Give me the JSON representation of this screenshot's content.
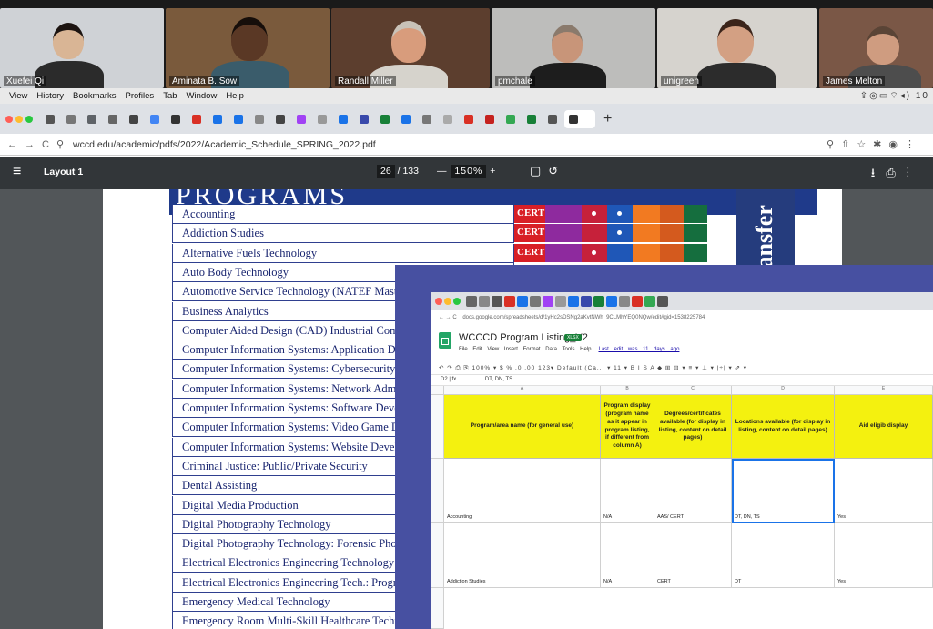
{
  "video_call": {
    "participants": [
      {
        "name": "Xuefei Qi",
        "bg": "#cfd2d6",
        "skin": "#d9b595",
        "hair": "#1c1411",
        "shirt": "#2b2b2b"
      },
      {
        "name": "Aminata B. Sow",
        "bg": "#7a5a3c",
        "skin": "#5a3825",
        "hair": "#160e0a",
        "shirt": "#3a5c6b"
      },
      {
        "name": "Randall Miller",
        "bg": "#5c3e2e",
        "skin": "#d89c7c",
        "hair": "#c9c2b8",
        "shirt": "#d6d3cc"
      },
      {
        "name": "pmchale",
        "bg": "#bdbdbb",
        "skin": "#c89579",
        "hair": "#8a7a6c",
        "shirt": "#1d1d1d"
      },
      {
        "name": "unigreen",
        "bg": "#d6d3ce",
        "skin": "#d3a083",
        "hair": "#3b241a",
        "shirt": "#2c2c2c"
      },
      {
        "name": "James Melton",
        "bg": "#7a5746",
        "skin": "#cf9c80",
        "hair": "#5a4436",
        "shirt": "#4d4d4d"
      }
    ]
  },
  "menubar": {
    "items": [
      "View",
      "History",
      "Bookmarks",
      "Profiles",
      "Tab",
      "Window",
      "Help"
    ],
    "clock": "10"
  },
  "browser": {
    "url": "wccd.edu/academic/pdfs/2022/Academic_Schedule_SPRING_2022.pdf",
    "new_tab": "+"
  },
  "pdf_toolbar": {
    "title": "Layout 1",
    "page_current": "26",
    "page_total": "/ 133",
    "zoom": "150%"
  },
  "pdf_page": {
    "heading": "PROGRAMS",
    "side_label": "ransfer",
    "cert_label": "CERT",
    "programs": [
      "Accounting",
      "Addiction Studies",
      "Alternative Fuels Technology",
      "Auto Body Technology",
      "Automotive Service Technology (NATEF Master)",
      "Business Analytics",
      "Computer Aided Design (CAD) Industrial Comp",
      "Computer Information Systems: Application Devel",
      "Computer Information Systems: Cybersecurity",
      "Computer Information Systems: Network Adminis",
      "Computer Information Systems: Software Develop",
      "Computer Information Systems: Video Game De",
      "Computer Information Systems: Website Develope",
      "Criminal Justice: Public/Private Security",
      "Dental Assisting",
      "Digital Media Production",
      "Digital Photography Technology",
      "Digital Photography Technology: Forensic Photo",
      "Electrical Electronics Engineering Technology",
      "Electrical Electronics Engineering Tech.: Progra",
      "Emergency Medical Technology",
      "Emergency Room Multi-Skill Healthcare Techno"
    ]
  },
  "sheet": {
    "url": "docs.google.com/spreadsheets/d/1yHc2sDSNg2aKvtNWh_9CLMhYEQ0NQw/edit#gid=1538225784",
    "title": "WCCCD Program Listing_V2",
    "badge": "XLSX",
    "menus": "File  Edit  View  Insert  Format  Data  Tools  Help",
    "last_edit": "Last edit was 11 days ago",
    "toolbar": "↶ ↷ ⎙ ⎘   100% ▾   $  %  .0  .00  123▾   Default (Ca... ▾   11 ▾   B  I  S  A   ◆  ⊞  ⊟ ▾   ≡ ▾  ⊥ ▾  |÷| ▾  ⇗ ▾",
    "cell_ref": "D2",
    "formula": "DT, DN, TS",
    "columns": [
      "A",
      "B",
      "C",
      "D",
      "E"
    ],
    "headers": [
      "Program/area name (for general use)",
      "Program display (program name as it appear in program listing, if different from column A)",
      "Degrees/certificates available (for display in listing, content on detail pages)",
      "Locations available (for display in listing, content on detail pages)",
      "Aid eligib display"
    ],
    "rows": [
      [
        "Accounting",
        "N/A",
        "AAS/ CERT",
        "DT, DN, TS",
        "Yes"
      ],
      [
        "Addiction Studies",
        "N/A",
        "CERT",
        "DT",
        "Yes"
      ]
    ]
  }
}
